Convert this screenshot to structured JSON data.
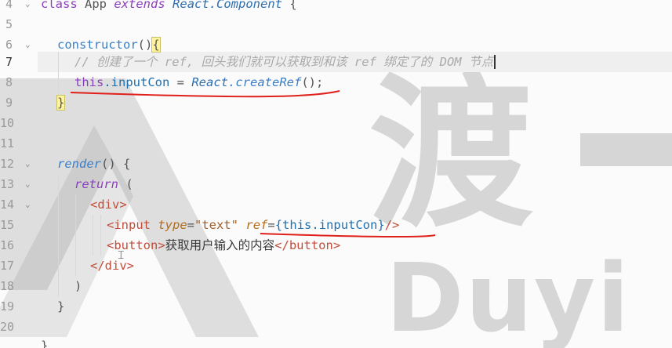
{
  "watermark": {
    "cn": "渡",
    "en": "Duyi"
  },
  "line_numbers": [
    "4",
    "5",
    "6",
    "7",
    "8",
    "9",
    "10",
    "11",
    "12",
    "13",
    "14",
    "15",
    "16",
    "17",
    "18",
    "19",
    "20"
  ],
  "code": {
    "l4": {
      "kw1": "class",
      "name": "App",
      "kw2": "extends",
      "base": "React.Component",
      "brace": "{"
    },
    "l6": {
      "name": "constructor",
      "paren": "()",
      "brace": "{"
    },
    "l7": {
      "comment_slashes": "//",
      "comment_1": "创建了一个",
      "comment_2": "ref,",
      "comment_3": "回头我们就可以获取到和该",
      "comment_4": "ref",
      "comment_5": "绑定了的",
      "comment_6": "DOM",
      "comment_7": "节点"
    },
    "l8": {
      "this": "this",
      "prop": ".inputCon",
      "eq": " = ",
      "react": "React",
      "method": ".createRef",
      "call": "();"
    },
    "l9": {
      "brace": "}"
    },
    "l12": {
      "name": "render",
      "paren": "()",
      "brace": " {"
    },
    "l13": {
      "kw": "return",
      "paren": " ("
    },
    "l14": {
      "tag": "<div>"
    },
    "l15": {
      "open": "<input",
      "attr1": "type",
      "eq1": "=",
      "val1": "\"text\"",
      "attr2": "ref",
      "eq2": "=",
      "expr": "{this.inputCon}",
      "close": "/>"
    },
    "l16": {
      "open": "<button>",
      "text": "获取用户输入的内容",
      "close": "</button>"
    },
    "l17": {
      "tag": "</div>"
    },
    "l18": {
      "paren": ")"
    },
    "l19": {
      "brace": "}"
    },
    "l21": {
      "brace": "}"
    }
  },
  "colors": {
    "annotation": "#e0201b"
  }
}
